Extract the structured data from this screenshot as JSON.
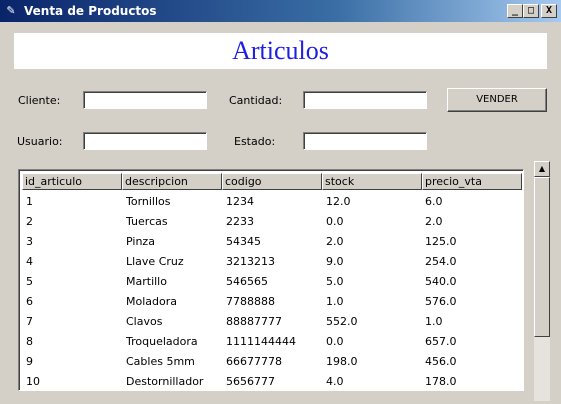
{
  "window": {
    "title": "Venta de Productos",
    "icon": "feather-icon",
    "controls": {
      "minimize": "_",
      "maximize": "□",
      "close": "X"
    }
  },
  "banner": {
    "title": "Articulos",
    "color": "#1f1fe0"
  },
  "form": {
    "cliente_label": "Cliente:",
    "cliente_value": "",
    "cantidad_label": "Cantidad:",
    "cantidad_value": "",
    "usuario_label": "Usuario:",
    "usuario_value": "",
    "estado_label": "Estado:",
    "estado_value": "",
    "vender_label": "VENDER"
  },
  "table": {
    "columns": [
      "id_articulo",
      "descripcion",
      "codigo",
      "stock",
      "precio_vta"
    ],
    "rows": [
      [
        "1",
        "Tornillos",
        "1234",
        "12.0",
        "6.0"
      ],
      [
        "2",
        "Tuercas",
        "2233",
        "0.0",
        "2.0"
      ],
      [
        "3",
        "Pinza",
        "54345",
        "2.0",
        "125.0"
      ],
      [
        "4",
        "Llave Cruz",
        "3213213",
        "9.0",
        "254.0"
      ],
      [
        "5",
        "Martillo",
        "546565",
        "5.0",
        "540.0"
      ],
      [
        "6",
        "Moladora",
        "7788888",
        "1.0",
        "576.0"
      ],
      [
        "7",
        "Clavos",
        "88887777",
        "552.0",
        "1.0"
      ],
      [
        "8",
        "Troqueladora",
        "1111144444",
        "0.0",
        "657.0"
      ],
      [
        "9",
        "Cables 5mm",
        "66677778",
        "198.0",
        "456.0"
      ],
      [
        "10",
        "Destornillador",
        "5656777",
        "4.0",
        "178.0"
      ]
    ]
  },
  "scrollbar": {
    "up_icon": "▲"
  }
}
